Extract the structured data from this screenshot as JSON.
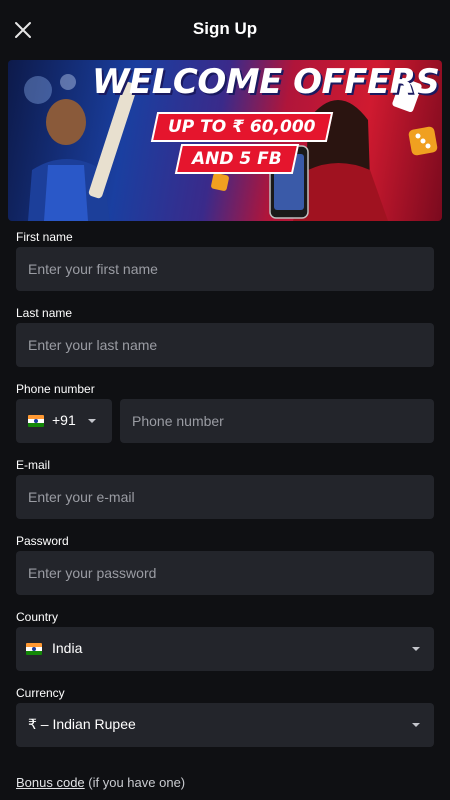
{
  "header": {
    "title": "Sign Up"
  },
  "banner": {
    "headline": "WELCOME OFFERS",
    "line1": "UP TO ₹ 60,000",
    "line2": "AND 5 FB"
  },
  "form": {
    "first_name": {
      "label": "First name",
      "placeholder": "Enter your first name"
    },
    "last_name": {
      "label": "Last name",
      "placeholder": "Enter your last name"
    },
    "phone": {
      "label": "Phone number",
      "dial_code": "+91",
      "placeholder": "Phone number"
    },
    "email": {
      "label": "E-mail",
      "placeholder": "Enter your e-mail"
    },
    "password": {
      "label": "Password",
      "placeholder": "Enter your password"
    },
    "country": {
      "label": "Country",
      "value": "India"
    },
    "currency": {
      "label": "Currency",
      "value": "₹ – Indian Rupee"
    }
  },
  "bonus": {
    "link": "Bonus code",
    "note": "(if you have one)"
  },
  "colors": {
    "background": "#0f1013",
    "field": "#23252b",
    "placeholder": "#9a9ca3",
    "accent_red": "#e5152d"
  }
}
